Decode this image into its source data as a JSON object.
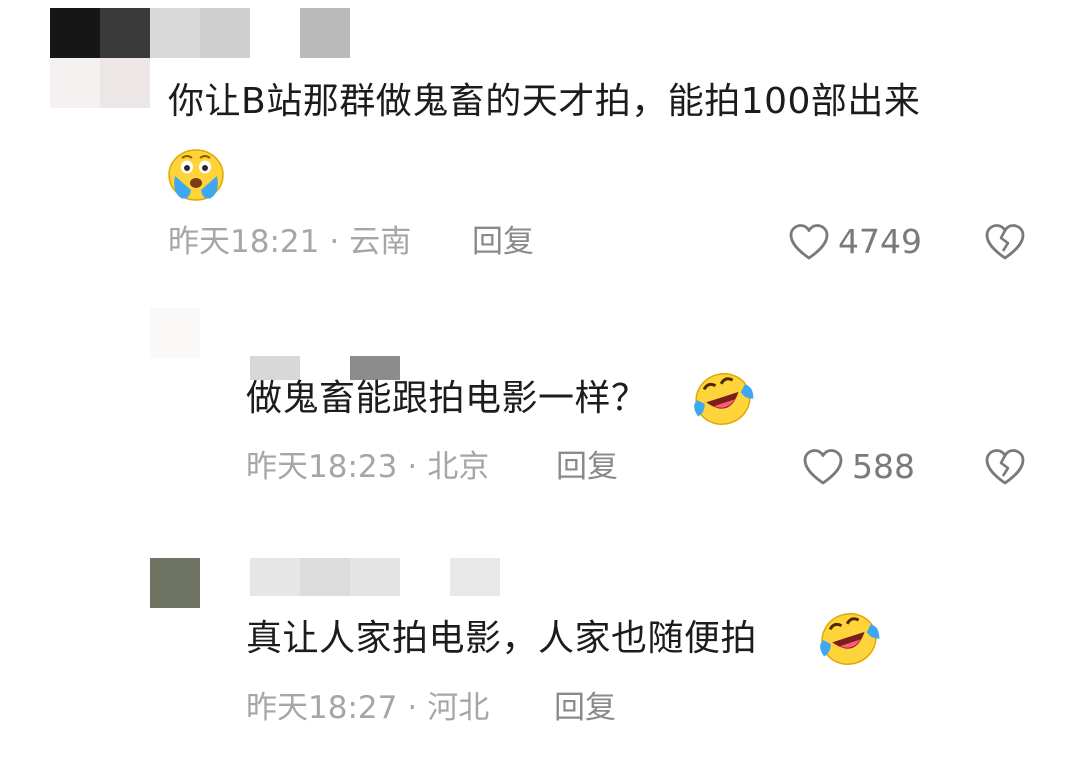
{
  "comments": [
    {
      "text": "你让B站那群做鬼畜的天才拍，能拍100部出来",
      "emoji": "crying-laughing-emoji",
      "time": "昨天18:21",
      "location": "云南",
      "reply_label": "回复",
      "likes": "4749"
    },
    {
      "text": "做鬼畜能跟拍电影一样？",
      "emoji": "rofl-emoji",
      "time": "昨天18:23",
      "location": "北京",
      "reply_label": "回复",
      "likes": "588"
    },
    {
      "text": "真让人家拍电影，人家也随便拍",
      "emoji": "rofl-emoji",
      "time": "昨天18:27",
      "location": "河北",
      "reply_label": "回复"
    }
  ],
  "separator": "·",
  "icons": {
    "like": "heart-outline-icon",
    "dislike": "broken-heart-icon"
  },
  "colors": {
    "text": "#1c1c1c",
    "meta": "#a6a6a6",
    "icon": "#7a7a7a",
    "emoji_face": "#ffd43b",
    "tears": "#3ea7f2"
  }
}
